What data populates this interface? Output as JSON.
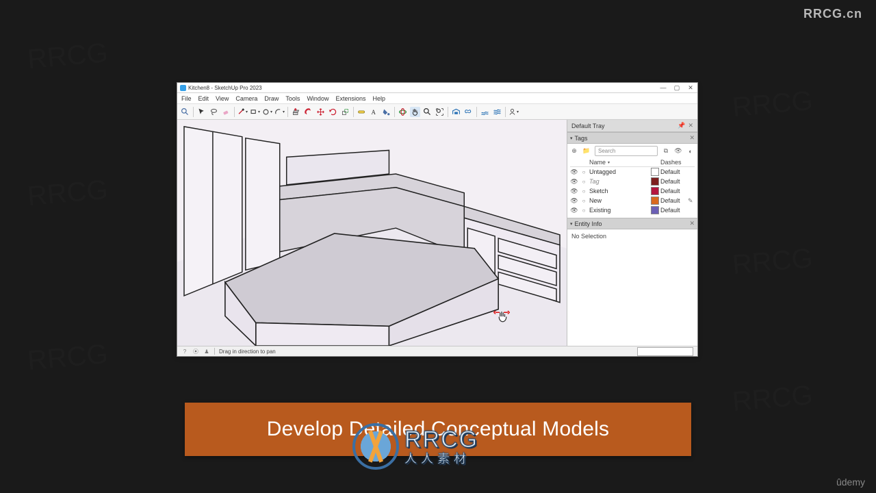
{
  "watermarks": {
    "top_right": "RRCG.cn",
    "bottom_right": "ûdemy",
    "bg_text": "RRCG",
    "center_badge_line1": "RRCG",
    "center_badge_line2": "人人素材"
  },
  "caption": {
    "text": "Develop Detailed Conceptual Models"
  },
  "app": {
    "title": "Kitchen8 - SketchUp Pro 2023",
    "win_controls": {
      "min": "—",
      "max": "▢",
      "close": "✕"
    },
    "menu": [
      "File",
      "Edit",
      "View",
      "Camera",
      "Draw",
      "Tools",
      "Window",
      "Extensions",
      "Help"
    ],
    "toolbar_icons": [
      "search-icon",
      "select-icon",
      "lasso-icon",
      "eraser-icon",
      "line-icon",
      "dropdown-icon",
      "rectangle-icon",
      "dropdown-icon",
      "circle-icon",
      "dropdown-icon",
      "arc-icon",
      "dropdown-icon",
      "pushpull-icon",
      "offset-icon",
      "move-icon",
      "rotate-icon",
      "scale-icon",
      "tape-icon",
      "text-icon",
      "paint-icon",
      "orbit-icon",
      "pan-icon",
      "zoom-icon",
      "zoom-extents-icon",
      "warehouse-icon",
      "layers-icon",
      "sandbox1-icon",
      "sandbox2-icon",
      "account-icon",
      "dropdown-icon"
    ],
    "tray": {
      "title": "Default Tray",
      "tags_header": "Tags",
      "search_placeholder": "Search",
      "name_col": "Name",
      "dashes_col": "Dashes",
      "rows": [
        {
          "name": "Untagged",
          "dashes": "Default",
          "swatch": "#ffffff",
          "italic": false
        },
        {
          "name": "Tag",
          "dashes": "Default",
          "swatch": "#7d1f1f",
          "italic": true
        },
        {
          "name": "Sketch",
          "dashes": "Default",
          "swatch": "#b4153e",
          "italic": false
        },
        {
          "name": "New",
          "dashes": "Default",
          "swatch": "#d9691e",
          "italic": false
        },
        {
          "name": "Existing",
          "dashes": "Default",
          "swatch": "#6b5fb5",
          "italic": false
        }
      ],
      "entity_header": "Entity Info",
      "entity_msg": "No Selection"
    },
    "status": {
      "hint": "Drag in direction to pan",
      "measure_label": ""
    }
  }
}
